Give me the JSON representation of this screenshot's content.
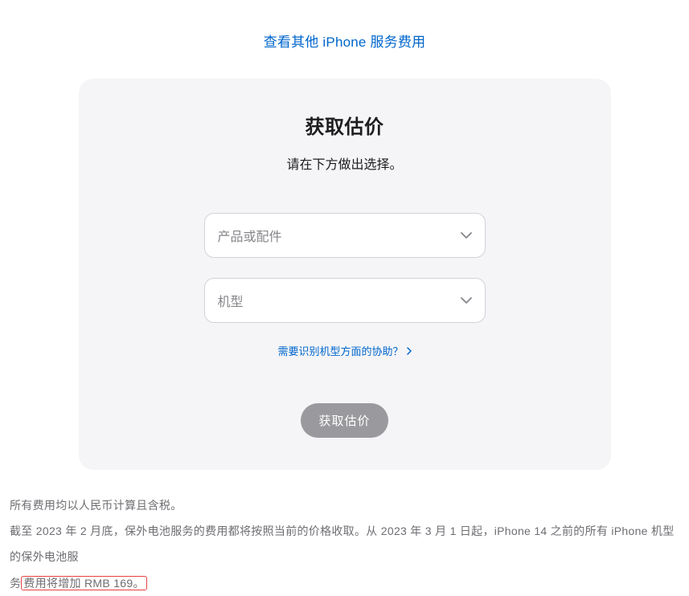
{
  "topLink": {
    "label": "查看其他 iPhone 服务费用"
  },
  "card": {
    "title": "获取估价",
    "subtitle": "请在下方做出选择。",
    "select1": {
      "placeholder": "产品或配件"
    },
    "select2": {
      "placeholder": "机型"
    },
    "helpLink": {
      "label": "需要识别机型方面的协助？"
    },
    "submitButton": {
      "label": "获取估价"
    }
  },
  "footer": {
    "line1": "所有费用均以人民币计算且含税。",
    "line2_part1": "截至 2023 年 2 月底，保外电池服务的费用都将按照当前的价格收取。从 2023 年 3 月 1 日起，iPhone 14 之前的所有 iPhone 机型的保外电池服",
    "line2_part2_prefix": "务",
    "line2_highlight": "费用将增加 RMB 169。"
  }
}
